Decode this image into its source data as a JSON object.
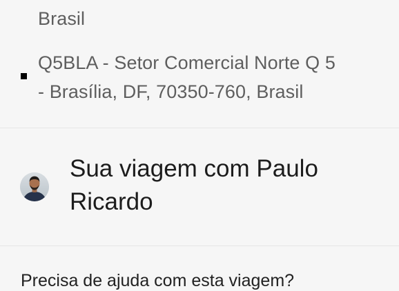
{
  "route": {
    "origin_tail": "Brasil",
    "destination_line1": "Q5BLA - Setor Comercial Norte Q 5",
    "destination_line2": "- Brasília, DF, 70350-760, Brasil"
  },
  "driver": {
    "trip_title_line1": "Sua viagem com Paulo",
    "trip_title_line2": "Ricardo"
  },
  "help": {
    "label": "Precisa de ajuda com esta viagem?"
  }
}
